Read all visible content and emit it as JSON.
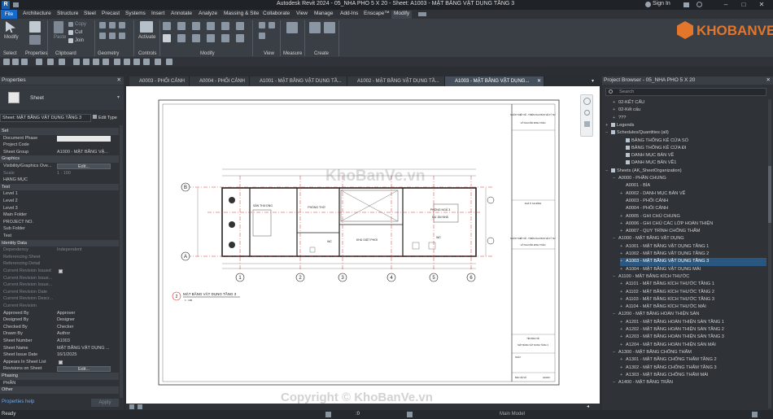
{
  "titlebar": {
    "title": "Autodesk Revit 2024 - 05_NHA PHO 5 X 20 - Sheet: A1003 - MẶT BẰNG VẬT DỤNG TẦNG 3",
    "sign_in": "Sign In"
  },
  "menu": [
    "File",
    "Architecture",
    "Structure",
    "Steel",
    "Precast",
    "Systems",
    "Insert",
    "Annotate",
    "Analyze",
    "Massing & Site",
    "Collaborate",
    "View",
    "Manage",
    "Add-Ins",
    "Enscape™",
    "Modify"
  ],
  "ribbon": {
    "modify_label": "Modify",
    "paste_label": "Paste",
    "copy_label": "Copy",
    "cut_label": "Cut",
    "join_label": "Join",
    "activate_label": "Activate",
    "groups": [
      "Select",
      "Properties",
      "Clipboard",
      "Geometry",
      "Controls",
      "Modify",
      "View",
      "Measure",
      "Create"
    ]
  },
  "properties": {
    "title": "Properties",
    "type_name": "Sheet",
    "selector": "Sheet: MẶT BẰNG VẬT DỤNG TẦNG 3",
    "edit_type": "Edit Type",
    "rows": [
      {
        "k": "Set",
        "sec": true
      },
      {
        "k": "Document Phase",
        "input": true
      },
      {
        "k": "Project Code"
      },
      {
        "k": "Sheet Group",
        "v": "A1000 - MẶT BẰNG VẬ..."
      },
      {
        "k": "Graphics",
        "sec": true
      },
      {
        "k": "Visibility/Graphics Ove...",
        "btn": "Edit..."
      },
      {
        "k": "Scale",
        "v": "1 : 100",
        "dim": true
      },
      {
        "k": "HẠNG MỤC"
      },
      {
        "k": "Text",
        "sec": true
      },
      {
        "k": "Level 1"
      },
      {
        "k": "Level 2"
      },
      {
        "k": "Level 3"
      },
      {
        "k": "Main Folder"
      },
      {
        "k": "PROJECT NO."
      },
      {
        "k": "Sub Folder"
      },
      {
        "k": "Test"
      },
      {
        "k": "Identity Data",
        "sec": true
      },
      {
        "k": "Dependency",
        "v": "Independent",
        "dim": true
      },
      {
        "k": "Referencing Sheet",
        "dim": true
      },
      {
        "k": "Referencing Detail",
        "dim": true
      },
      {
        "k": "Current Revision Issued",
        "dim": true,
        "chk": true
      },
      {
        "k": "Current Revision Issue...",
        "dim": true
      },
      {
        "k": "Current Revision Issue...",
        "dim": true
      },
      {
        "k": "Current Revision Date",
        "dim": true
      },
      {
        "k": "Current Revision Descr...",
        "dim": true
      },
      {
        "k": "Current Revision",
        "dim": true
      },
      {
        "k": "Approved By",
        "v": "Approver"
      },
      {
        "k": "Designed By",
        "v": "Designer"
      },
      {
        "k": "Checked By",
        "v": "Checker"
      },
      {
        "k": "Drawn By",
        "v": "Author"
      },
      {
        "k": "Sheet Number",
        "v": "A1003"
      },
      {
        "k": "Sheet Name",
        "v": "MẶT BẰNG VẬT DỤNG ..."
      },
      {
        "k": "Sheet Issue Date",
        "v": "16/1/2025"
      },
      {
        "k": "Appears In Sheet List",
        "chk": true
      },
      {
        "k": "Revisions on Sheet",
        "btn": "Edit..."
      },
      {
        "k": "Phasing",
        "sec": true
      },
      {
        "k": "PHẦN"
      },
      {
        "k": "Other",
        "sec": true
      }
    ],
    "help": "Properties help",
    "apply": "Apply"
  },
  "view_tabs": [
    {
      "label": "A0003 - PHỐI CẢNH"
    },
    {
      "label": "A0004 - PHỐI CẢNH"
    },
    {
      "label": "A1001 - MẶT BẰNG VẬT DỤNG TẦ..."
    },
    {
      "label": "A1002 - MẶT BẰNG VẬT DỤNG TẦ..."
    },
    {
      "label": "A1003 - MẶT BẰNG VẬT DỤNG..."
    }
  ],
  "drawing": {
    "room1": "SÂN THƯỢNG",
    "room2": "PHÒNG THỜ",
    "room3": "PHÒNG NGỦ 3",
    "room3b": "DỰ ÁN NHÀ",
    "room4": "KHU GIẶT PHƠI",
    "room5": "WC",
    "room6": "WC",
    "view_number": "2",
    "view_title": "MẶT BẰNG VẬT DỤNG TẦNG 3",
    "view_scale": "1 : 100",
    "tb_company": "NHÂN THIẾT KẾ - TRIỂN KHAI BẢN VẼ KỸ SƯ",
    "tb_designer": "VÕ NGUYỄN MINH TOÀN",
    "tb_owner": "NHÀ Ở GIA ĐÌNH",
    "tb_sheet_label": "TÊN BẢN VẼ",
    "tb_sheet_name": "MẶT BẰNG VẬT DỤNG TẦNG 3",
    "tb_date_label": "NGÀY",
    "tb_no_label": "BẢN VẼ SỐ",
    "tb_no": "A1003",
    "grids_bottom": [
      "1",
      "2",
      "3",
      "4",
      "5",
      "6"
    ],
    "grids_left": [
      "B",
      "A"
    ]
  },
  "browser": {
    "title": "Project Browser - 05_NHA PHO 5 X 20",
    "search": "Search",
    "items": [
      {
        "t": "02-KẾT CẤU",
        "i": 1,
        "tg": "+"
      },
      {
        "t": "02-Kết cấu",
        "i": 1,
        "tg": "+"
      },
      {
        "t": "???",
        "i": 1,
        "tg": "+"
      },
      {
        "t": "Legends",
        "i": 0,
        "tg": "+",
        "sq": true
      },
      {
        "t": "Schedules/Quantities (all)",
        "i": 0,
        "tg": "−",
        "sq": true
      },
      {
        "t": "BẢNG THỐNG KÊ CỬA SỔ",
        "i": 2,
        "sq": true
      },
      {
        "t": "BẢNG THỐNG KÊ CỬA ĐI",
        "i": 2,
        "sq": true
      },
      {
        "t": "DANH MỤC BẢN VẼ",
        "i": 2,
        "sq": true
      },
      {
        "t": "DANH MỤC BẢN VẼ1",
        "i": 2,
        "sq": true
      },
      {
        "t": "Sheets (AK_SheetOrganization)",
        "i": 0,
        "tg": "−",
        "sq": true
      },
      {
        "t": "A0000 - PHẦN CHUNG",
        "i": 1,
        "tg": "−"
      },
      {
        "t": "A0001 - BÌA",
        "i": 2
      },
      {
        "t": "A0002 - DANH MỤC BẢN VẼ",
        "i": 2,
        "tg": "+"
      },
      {
        "t": "A0003 - PHỐI CẢNH",
        "i": 2
      },
      {
        "t": "A0004 - PHỐI CẢNH",
        "i": 2
      },
      {
        "t": "A0005 - GHI CHÚ CHUNG",
        "i": 2,
        "tg": "+"
      },
      {
        "t": "A0006 - GHI CHÚ CÁC LỚP HOÀN THIỆN",
        "i": 2,
        "tg": "+"
      },
      {
        "t": "A0007 - QUY TRÌNH CHỐNG THẤM",
        "i": 2,
        "tg": "+"
      },
      {
        "t": "A1000 - MẶT BẰNG VẬT DỤNG",
        "i": 1,
        "tg": "−"
      },
      {
        "t": "A1001 - MẶT BẰNG VẬT DỤNG TẦNG 1",
        "i": 2,
        "tg": "+"
      },
      {
        "t": "A1002 - MẶT BẰNG VẬT DỤNG TẦNG 2",
        "i": 2,
        "tg": "+"
      },
      {
        "t": "A1003 - MẶT BẰNG VẬT DỤNG TẦNG 3",
        "i": 2,
        "tg": "+",
        "sel": true
      },
      {
        "t": "A1004 - MẶT BẰNG VẬT DỤNG MÁI",
        "i": 2,
        "tg": "+"
      },
      {
        "t": "A1100 - MẶT BẰNG KÍCH THƯỚC",
        "i": 1,
        "tg": "−"
      },
      {
        "t": "A1101 - MẶT BẰNG KÍCH THƯỚC TẦNG 1",
        "i": 2,
        "tg": "+"
      },
      {
        "t": "A1102 - MẶT BẰNG KÍCH THƯỚC TẦNG 2",
        "i": 2,
        "tg": "+"
      },
      {
        "t": "A1103 - MẶT BẰNG KÍCH THƯỚC TẦNG 3",
        "i": 2,
        "tg": "+"
      },
      {
        "t": "A1104 - MẶT BẰNG KÍCH THƯỚC MÁI",
        "i": 2,
        "tg": "+"
      },
      {
        "t": "A1200 - MẶT BẰNG HOÀN THIỆN SÀN",
        "i": 1,
        "tg": "−"
      },
      {
        "t": "A1201 - MẶT BẰNG HOÀN THIỆN SÀN TẦNG 1",
        "i": 2,
        "tg": "+"
      },
      {
        "t": "A1202 - MẶT BẰNG HOÀN THIỆN SÀN TẦNG 2",
        "i": 2,
        "tg": "+"
      },
      {
        "t": "A1203 - MẶT BẰNG HOÀN THIỆN SÀN TẦNG 3",
        "i": 2,
        "tg": "+"
      },
      {
        "t": "A1204 - MẶT BẰNG HOÀN THIỆN SÀN MÁI",
        "i": 2,
        "tg": "+"
      },
      {
        "t": "A1300 - MẶT BẰNG CHỐNG THẤM",
        "i": 1,
        "tg": "−"
      },
      {
        "t": "A1301 - MẶT BẰNG CHỐNG THẤM TẦNG 2",
        "i": 2,
        "tg": "+"
      },
      {
        "t": "A1302 - MẶT BẰNG CHỐNG THẤM TẦNG 3",
        "i": 2,
        "tg": "+"
      },
      {
        "t": "A1303 - MẶT BẰNG CHỐNG THẤM MÁI",
        "i": 2,
        "tg": "+"
      },
      {
        "t": "A1400 - MẶT BẰNG TRẦN",
        "i": 1,
        "tg": "−"
      }
    ]
  },
  "status": {
    "ready": "Ready",
    "model": "Main Model",
    "zero": ":0"
  },
  "watermarks": {
    "logo": "KHOBANVE",
    "center": "KhoBanVe.vn",
    "copyright": "Copyright © KhoBanVe.vn"
  },
  "colors": {
    "file_tab": "#1669c9",
    "selected": "#29577f",
    "grid_red": "#d03030",
    "logo_orange": "#e3762a"
  }
}
